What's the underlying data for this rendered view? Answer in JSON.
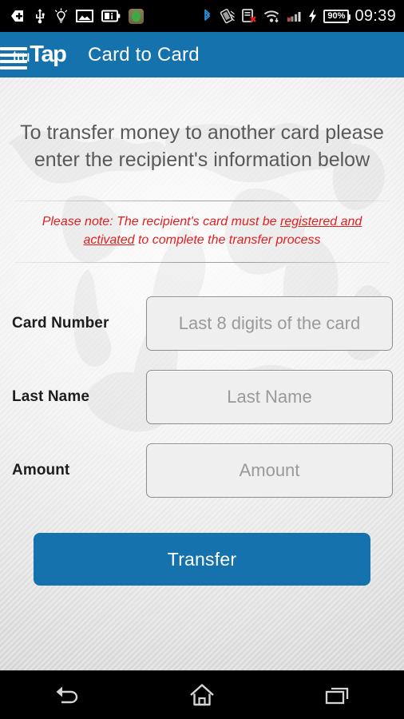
{
  "statusbar": {
    "icons_left": [
      "sdcard-eject-icon",
      "usb-icon",
      "flashlight-icon",
      "gallery-icon",
      "battery-info-icon",
      "app-notification-icon"
    ],
    "icons_right": [
      "bluetooth-icon",
      "screen-rotation-off-icon",
      "sync-error-icon",
      "wifi-icon",
      "signal-error-icon",
      "cellular-signal-icon",
      "charging-bolt-icon"
    ],
    "battery_percent": "90%",
    "clock": "09:39"
  },
  "appbar": {
    "menu_icon": "hamburger-menu-icon",
    "logo_light": "tru",
    "logo_bold": "Tap",
    "title": "Card to Card",
    "accent_color": "#1572ac"
  },
  "content": {
    "intro_line1": "To transfer money to another card please",
    "intro_line2": "enter the recipient's information below",
    "note_prefix": "Please note: The recipient's card must be ",
    "note_underline1": "registered and",
    "note_middle": " ",
    "note_underline2": "activated",
    "note_suffix": " to complete the transfer process",
    "note_color": "#e02020"
  },
  "form": {
    "fields": [
      {
        "label": "Card Number",
        "placeholder": "Last 8 digits of the card",
        "value": ""
      },
      {
        "label": "Last Name",
        "placeholder": "Last Name",
        "value": ""
      },
      {
        "label": "Amount",
        "placeholder": "Amount",
        "value": ""
      }
    ],
    "submit_label": "Transfer"
  },
  "navbar": {
    "back": "back-icon",
    "home": "home-icon",
    "recents": "recent-apps-icon"
  }
}
